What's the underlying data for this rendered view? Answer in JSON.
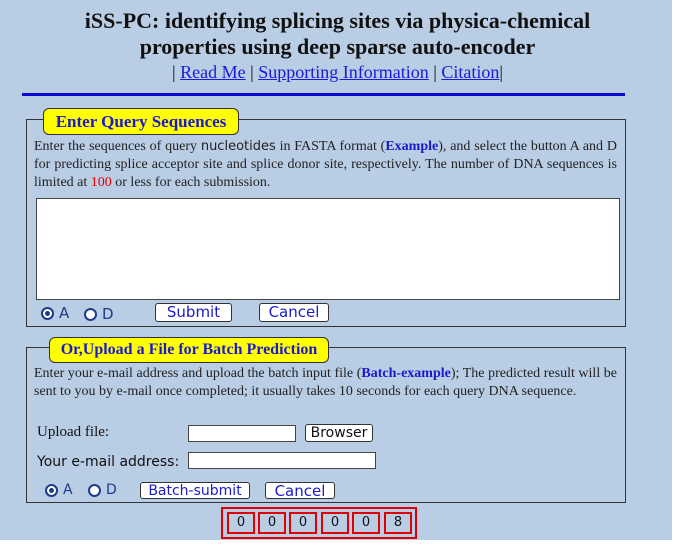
{
  "header": {
    "title_line1": "iSS-PC: identifying splicing sites via physica-chemical",
    "title_line2": "properties using deep sparse auto-encoder",
    "links": [
      {
        "label": "Read Me"
      },
      {
        "label": "Supporting Information"
      },
      {
        "label": "Citation"
      }
    ],
    "separator": "|"
  },
  "query_section": {
    "legend": "Enter Query Sequences",
    "text_part1": "Enter the sequences of query ",
    "text_mono": "nucleotides",
    "text_part2": "  in FASTA format (",
    "example_link": "Example",
    "text_part3": "), and select the button A and D for predicting splice acceptor site and splice donor site, respectively. The number of DNA sequences is limited at ",
    "limit": "100",
    "text_part4": " or less for each submission.",
    "sequence_input_value": "",
    "radio_options": [
      {
        "label": "A",
        "selected": true
      },
      {
        "label": "D",
        "selected": false
      }
    ],
    "submit_label": "Submit",
    "cancel_label": "Cancel"
  },
  "batch_section": {
    "legend": "Or,Upload a File for Batch Prediction",
    "text_part1": "Enter your e-mail address and upload the batch input file (",
    "example_link": "Batch-example",
    "text_part2": ");  The predicted result will be sent to you by e-mail once completed; it usually takes 10 seconds for each query DNA sequence.",
    "upload_label": "Upload file:",
    "upload_value": "",
    "browse_label": "Browser",
    "email_label": "Your e-mail address:",
    "email_value": "",
    "radio_options": [
      {
        "label": "A",
        "selected": true
      },
      {
        "label": "D",
        "selected": false
      }
    ],
    "submit_label": "Batch-submit",
    "cancel_label": "Cancel"
  },
  "visit_counter": {
    "digits": [
      "0",
      "0",
      "0",
      "0",
      "0",
      "8"
    ]
  }
}
